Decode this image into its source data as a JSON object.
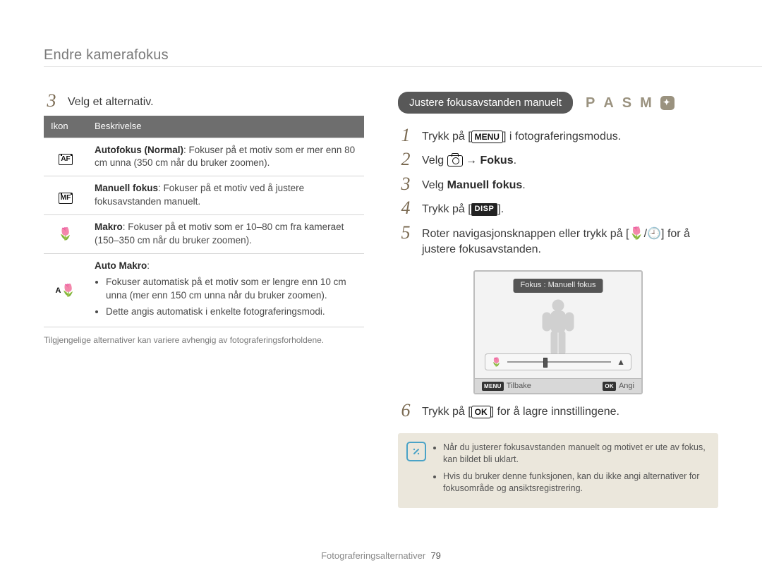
{
  "page_title": "Endre kamerafokus",
  "footer": {
    "section": "Fotograferingsalternativer",
    "page": "79"
  },
  "left": {
    "step_num": "3",
    "step_text": "Velg et alternativ.",
    "table": {
      "col_icon": "Ikon",
      "col_desc": "Beskrivelse",
      "rows": [
        {
          "icon": "[AF]",
          "term": "Autofokus (Normal)",
          "desc": ": Fokuser på et motiv som er mer enn 80 cm unna (350 cm når du bruker zoomen)."
        },
        {
          "icon": "[MF]",
          "term": "Manuell fokus",
          "desc": ": Fokuser på et motiv ved å justere fokusavstanden manuelt."
        },
        {
          "icon": "🌷",
          "term": "Makro",
          "desc": ": Fokuser på et motiv som er 10–80 cm fra kameraet (150–350 cm når du bruker zoomen)."
        },
        {
          "icon": "A🌷",
          "term": "Auto Makro",
          "desc": ":",
          "bullets": [
            "Fokuser automatisk på et motiv som er lengre enn 10 cm unna (mer enn 150 cm unna når du bruker zoomen).",
            "Dette angis automatisk i enkelte fotograferingsmodi."
          ]
        }
      ]
    },
    "footnote": "Tilgjengelige alternativer kan variere avhengig av fotograferingsforholdene."
  },
  "right": {
    "pill": "Justere fokusavstanden manuelt",
    "modes": [
      "P",
      "A",
      "S",
      "M"
    ],
    "steps": {
      "n1": "1",
      "t1_a": "Trykk på [",
      "t1_menu": "MENU",
      "t1_b": "] i fotograferingsmodus.",
      "n2": "2",
      "t2_a": "Velg ",
      "t2_b": " → ",
      "t2_bold": "Fokus",
      "t2_c": ".",
      "n3": "3",
      "t3_a": "Velg ",
      "t3_bold": "Manuell fokus",
      "t3_b": ".",
      "n4": "4",
      "t4_a": "Trykk på [",
      "t4_disp": "DISP",
      "t4_b": "].",
      "n5": "5",
      "t5_a": "Roter navigasjonsknappen eller trykk på [",
      "t5_mid": "/",
      "t5_b": "] for å justere fokusavstanden.",
      "n6": "6",
      "t6_a": "Trykk på [",
      "t6_ok": "OK",
      "t6_b": "] for å lagre innstillingene."
    },
    "lcd": {
      "badge": "Fokus : Manuell fokus",
      "back_key": "MENU",
      "back_label": "Tilbake",
      "set_key": "OK",
      "set_label": "Angi"
    },
    "note": {
      "b1": "Når du justerer fokusavstanden manuelt og motivet er ute av fokus, kan bildet bli uklart.",
      "b2": "Hvis du bruker denne funksjonen, kan du ikke angi alternativer for fokusområde og ansiktsregistrering."
    }
  }
}
